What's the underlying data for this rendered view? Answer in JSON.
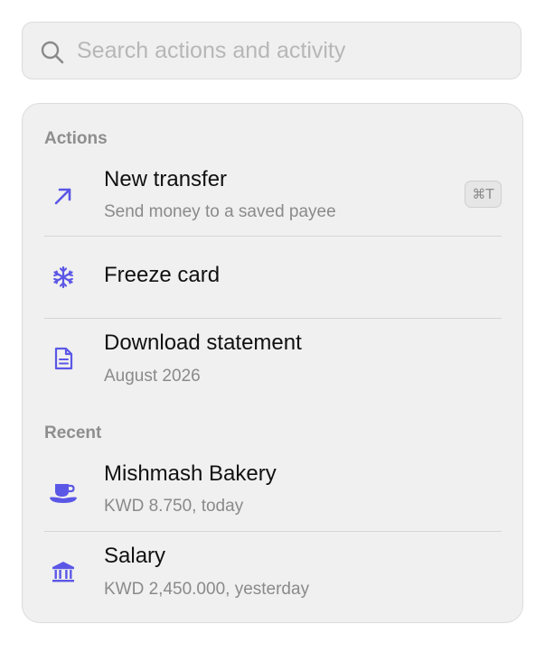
{
  "search": {
    "placeholder": "Search actions and activity",
    "value": "",
    "icon": "search-icon"
  },
  "sections": {
    "actions_label": "Actions",
    "recent_label": "Recent"
  },
  "actions": [
    {
      "title": "New transfer",
      "subtitle": "Send money to a saved payee",
      "icon": "arrow-up-right-icon",
      "shortcut": "⌘T"
    },
    {
      "title": "Freeze card",
      "subtitle": "",
      "icon": "snowflake-icon"
    },
    {
      "title": "Download statement",
      "subtitle": "August 2026",
      "icon": "document-icon"
    }
  ],
  "recent": [
    {
      "title": "Mishmash Bakery",
      "subtitle": "KWD 8.750, today",
      "icon": "coffee-cup-icon"
    },
    {
      "title": "Salary",
      "subtitle": "KWD 2,450.000, yesterday",
      "icon": "bank-icon"
    }
  ],
  "colors": {
    "accent": "#5b57e6",
    "panel_bg": "#f0f0f0",
    "secondary_text": "#8a8a8a"
  }
}
